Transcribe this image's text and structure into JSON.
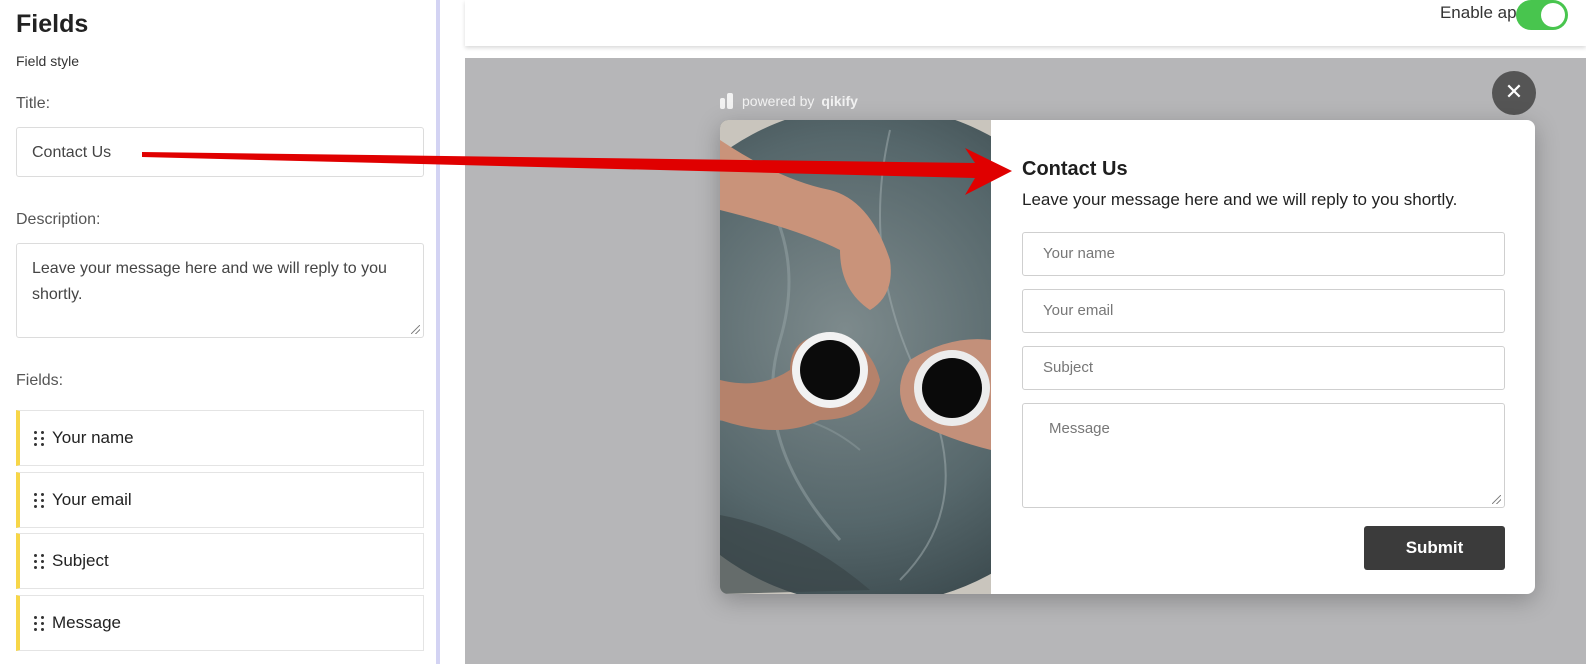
{
  "sidebar": {
    "heading": "Fields",
    "subheading": "Field style",
    "title_label": "Title:",
    "title_value": "Contact Us",
    "description_label": "Description:",
    "description_value": "Leave your message here and we will reply to you shortly.",
    "fields_label": "Fields:",
    "fields": [
      {
        "label": "Your name"
      },
      {
        "label": "Your email"
      },
      {
        "label": "Subject"
      },
      {
        "label": "Message"
      }
    ],
    "field_accent_color": "#f7d648"
  },
  "topbar": {
    "enable_label": "Enable app",
    "enabled": true,
    "toggle_color": "#48c54e"
  },
  "preview": {
    "powered_prefix": "powered by",
    "powered_brand": "qikify",
    "close_icon": "close-icon",
    "form": {
      "title": "Contact Us",
      "description": "Leave your message here and we will reply to you shortly.",
      "name_placeholder": "Your name",
      "email_placeholder": "Your email",
      "subject_placeholder": "Subject",
      "message_placeholder": "Message",
      "submit_label": "Submit",
      "submit_color": "#3b3b3b"
    },
    "annotation_arrow_color": "#e00000"
  }
}
